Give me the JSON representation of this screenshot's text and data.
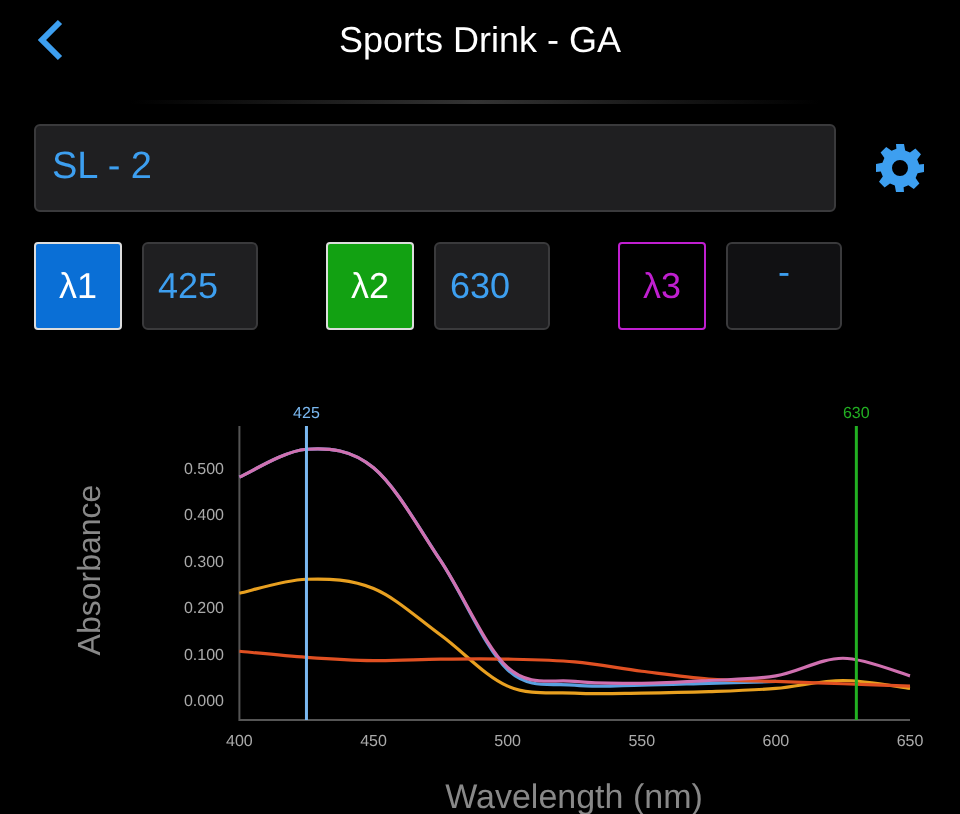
{
  "header": {
    "title": "Sports Drink - GA"
  },
  "sample": {
    "value": "SL - 2"
  },
  "wavelengths": [
    {
      "label": "λ1",
      "value": "425",
      "color": "#0a6fd6",
      "active": true
    },
    {
      "label": "λ2",
      "value": "630",
      "color": "#12a112",
      "active": true
    },
    {
      "label": "λ3",
      "value": "-",
      "color": "#c01fd0",
      "active": false
    }
  ],
  "chart_data": {
    "type": "line",
    "xlabel": "Wavelength (nm)",
    "ylabel": "Absorbance",
    "x": [
      400,
      425,
      450,
      475,
      500,
      525,
      550,
      575,
      600,
      625,
      650
    ],
    "series": [
      {
        "color": "#5aa0e0",
        "values": [
          0.48,
          0.54,
          0.5,
          0.3,
          0.065,
          0.032,
          0.032,
          0.036,
          0.04,
          null,
          null
        ]
      },
      {
        "color": "#e8a020",
        "values": [
          0.23,
          0.26,
          0.24,
          0.14,
          0.03,
          0.015,
          0.015,
          0.018,
          0.025,
          0.042,
          0.025
        ]
      },
      {
        "color": "#e05022",
        "values": [
          0.105,
          0.092,
          0.085,
          0.088,
          0.088,
          0.082,
          0.062,
          0.045,
          0.04,
          0.035,
          0.03
        ]
      },
      {
        "color": "#d070b0",
        "values": [
          0.48,
          0.54,
          0.5,
          0.3,
          0.07,
          0.04,
          0.036,
          0.042,
          0.052,
          0.09,
          0.052
        ]
      }
    ],
    "xlim": [
      400,
      650
    ],
    "ylim": [
      -0.043,
      0.59
    ],
    "xticks": [
      400,
      450,
      500,
      550,
      600,
      650
    ],
    "yticks": [
      {
        "value": 0,
        "label": "0.000"
      },
      {
        "value": 0.1,
        "label": "0.100"
      },
      {
        "value": 0.2,
        "label": "0.200"
      },
      {
        "value": 0.3,
        "label": "0.300"
      },
      {
        "value": 0.4,
        "label": "0.400"
      },
      {
        "value": 0.5,
        "label": "0.500"
      }
    ],
    "ref_lines": [
      {
        "axis": "x",
        "value": 425,
        "label": "425",
        "color": "#7ab8f0"
      },
      {
        "axis": "x",
        "value": 630,
        "label": "630",
        "color": "#22b022"
      }
    ]
  }
}
